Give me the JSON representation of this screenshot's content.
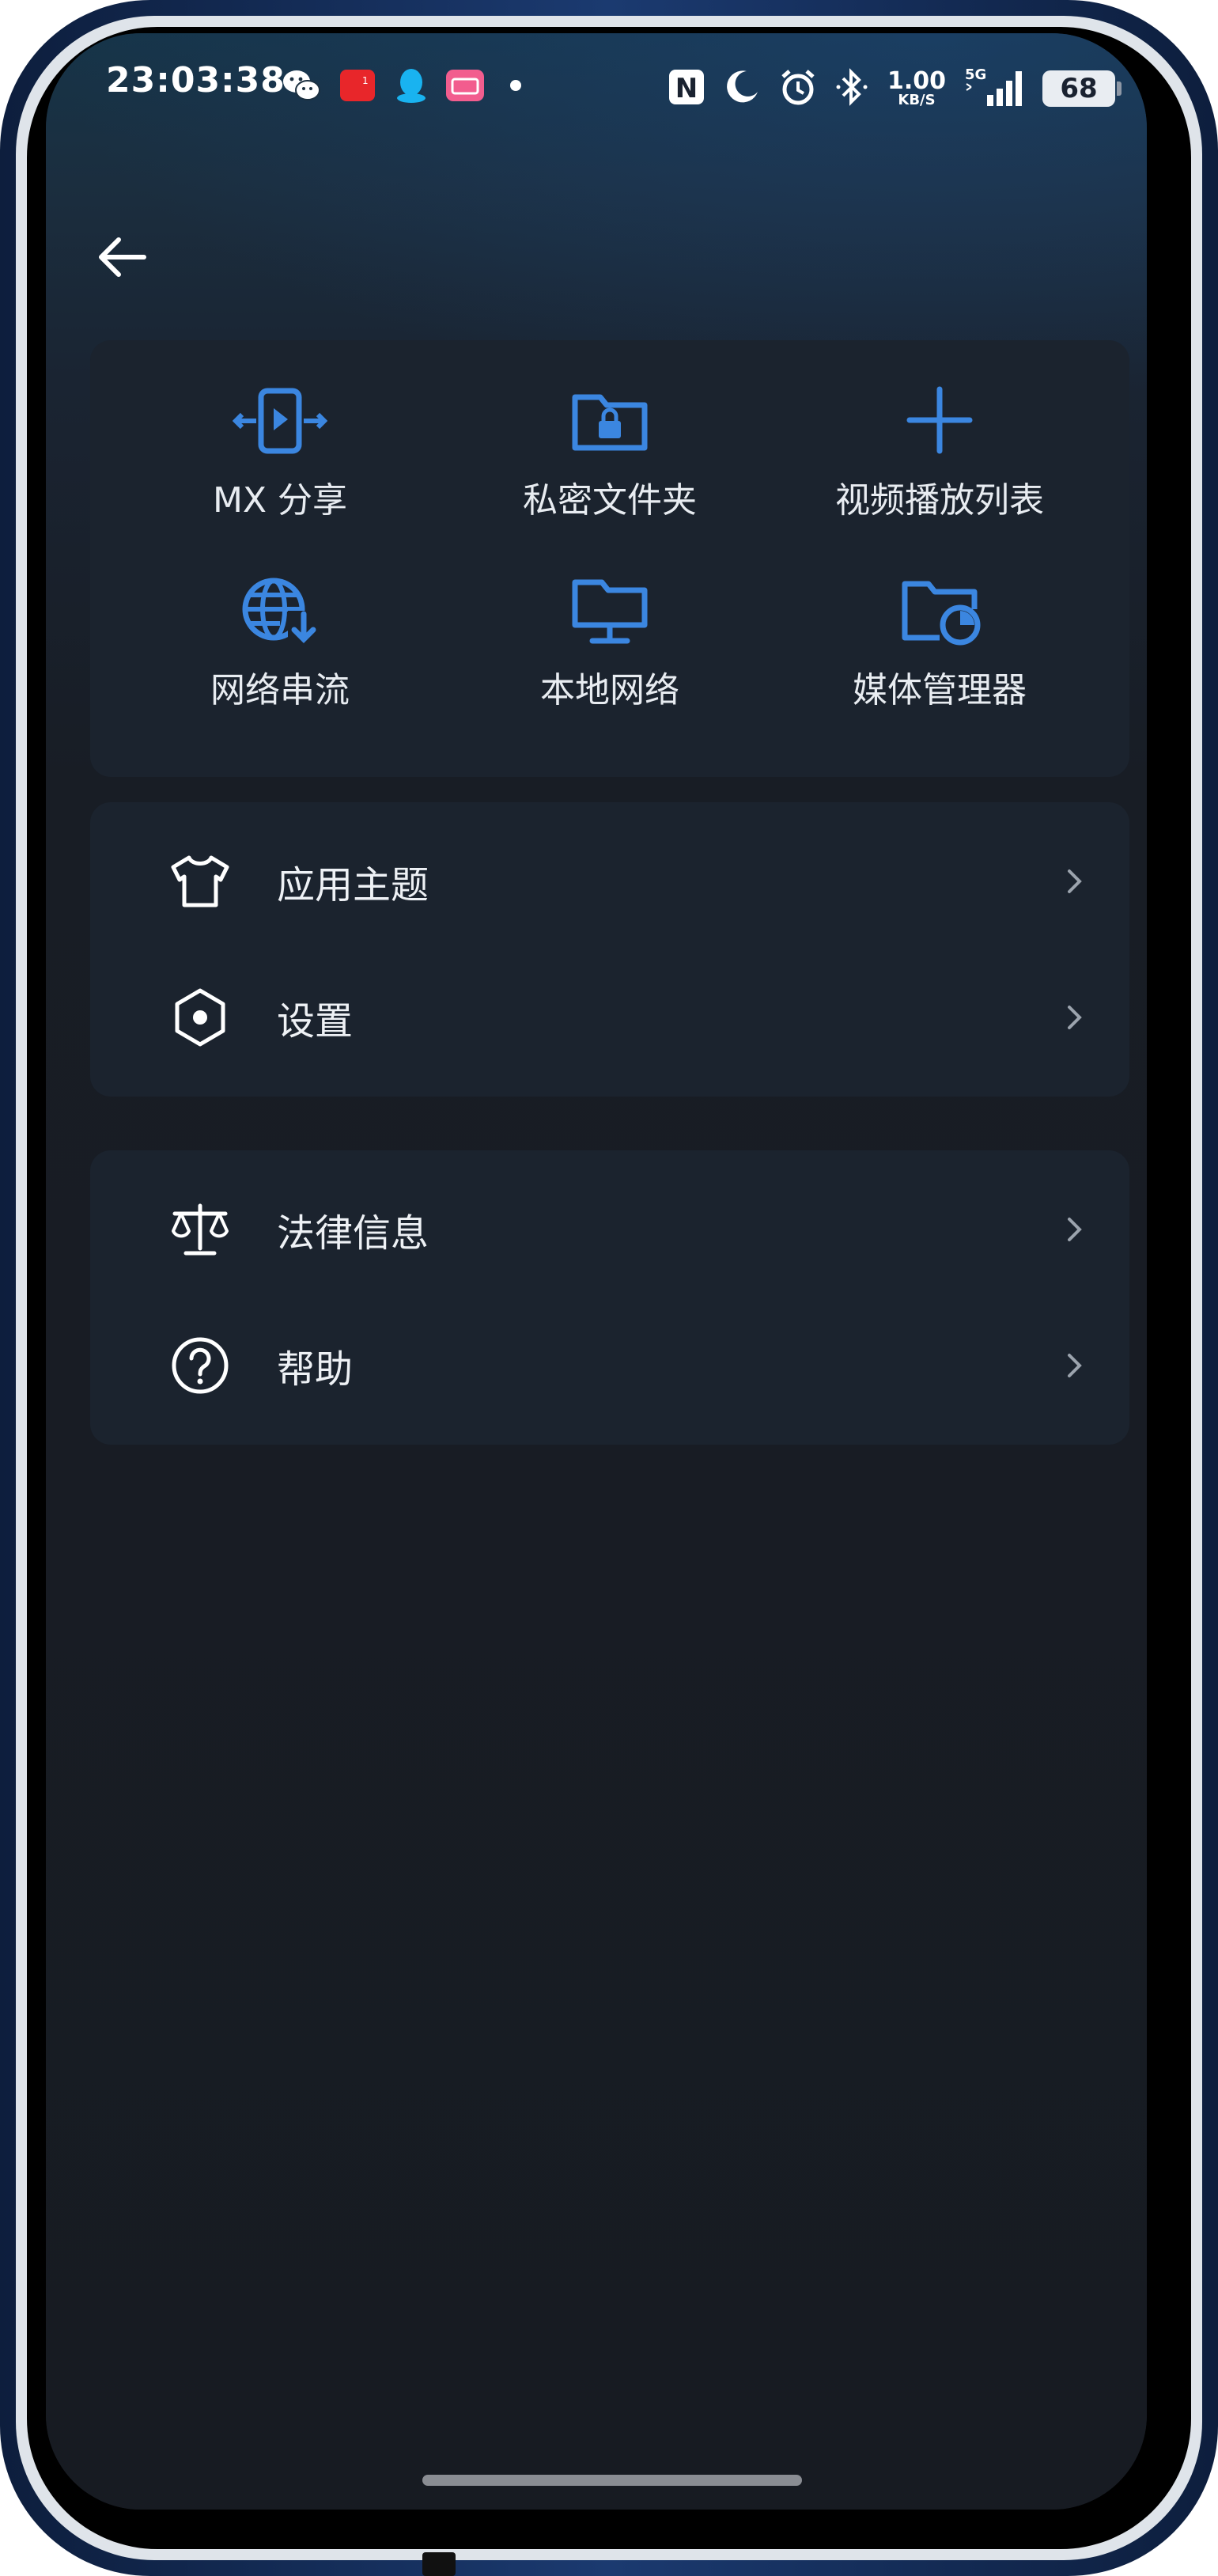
{
  "status_bar": {
    "time": "23:03:38",
    "notification_icons": [
      "wechat-icon",
      "red-app-icon",
      "qq-icon",
      "bilibili-icon",
      "dot-icon"
    ],
    "nfc": "N",
    "net_speed_value": "1.00",
    "net_speed_unit": "KB/S",
    "network": "5G",
    "battery": "68"
  },
  "header": {
    "back_icon": "arrow-left-icon"
  },
  "features": [
    {
      "label": "MX 分享",
      "icon": "mx-share-icon"
    },
    {
      "label": "私密文件夹",
      "icon": "locked-folder-icon"
    },
    {
      "label": "视频播放列表",
      "icon": "plus-icon"
    },
    {
      "label": "网络串流",
      "icon": "globe-download-icon"
    },
    {
      "label": "本地网络",
      "icon": "monitor-icon"
    },
    {
      "label": "媒体管理器",
      "icon": "folder-clock-icon"
    }
  ],
  "menu_group_1": [
    {
      "label": "应用主题",
      "icon": "tshirt-icon"
    },
    {
      "label": "设置",
      "icon": "hexagon-gear-icon"
    }
  ],
  "menu_group_2": [
    {
      "label": "法律信息",
      "icon": "scales-icon"
    },
    {
      "label": "帮助",
      "icon": "question-circle-icon"
    }
  ],
  "colors": {
    "accent": "#3b86e0",
    "background": "#171b22",
    "card": "#1b232e",
    "text": "#eef1f5"
  }
}
